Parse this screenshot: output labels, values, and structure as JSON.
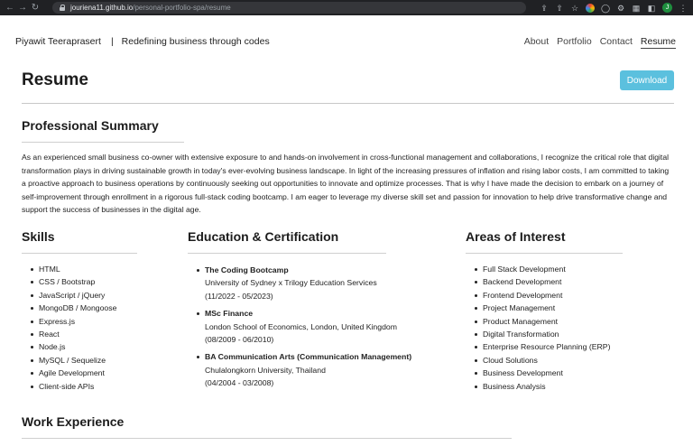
{
  "browser": {
    "url_host": "jouriena11.github.io",
    "url_path": "/personal-portfolio-spa/resume",
    "profile_initial": "J"
  },
  "header": {
    "name": "Piyawit Teeraprasert",
    "separator": "|",
    "tagline": "Redefining business through codes",
    "nav": [
      "About",
      "Portfolio",
      "Contact",
      "Resume"
    ],
    "active_nav": "Resume"
  },
  "page": {
    "title": "Resume",
    "download_label": "Download",
    "accent_color": "#5bc0de"
  },
  "summary": {
    "heading": "Professional Summary",
    "text": "As an experienced small business co-owner with extensive exposure to and hands-on involvement in cross-functional management and collaborations, I recognize the critical role that digital transformation plays in driving sustainable growth in today's ever-evolving business landscape. In light of the increasing pressures of inflation and rising labor costs, I am committed to taking a proactive approach to business operations by continuously seeking out opportunities to innovate and optimize processes. That is why I have made the decision to embark on a journey of self-improvement through enrollment in a rigorous full-stack coding bootcamp. I am eager to leverage my diverse skill set and passion for innovation to help drive transformative change and support the success of businesses in the digital age."
  },
  "skills": {
    "heading": "Skills",
    "items": [
      "HTML",
      "CSS / Bootstrap",
      "JavaScript / jQuery",
      "MongoDB / Mongoose",
      "Express.js",
      "React",
      "Node.js",
      "MySQL / Sequelize",
      "Agile Development",
      "Client-side APIs"
    ]
  },
  "education": {
    "heading": "Education & Certification",
    "items": [
      {
        "degree": "The Coding Bootcamp",
        "institution": "University of Sydney x Trilogy Education Services",
        "dates": "(11/2022 - 05/2023)"
      },
      {
        "degree": "MSc Finance",
        "institution": "London School of Economics, London, United Kingdom",
        "dates": "(08/2009 - 06/2010)"
      },
      {
        "degree": "BA Communication Arts (Communication Management)",
        "institution": "Chulalongkorn University, Thailand",
        "dates": "(04/2004 - 03/2008)"
      }
    ]
  },
  "interests": {
    "heading": "Areas of Interest",
    "items": [
      "Full Stack Development",
      "Backend Development",
      "Frontend Development",
      "Project Management",
      "Product Management",
      "Digital Transformation",
      "Enterprise Resource Planning (ERP)",
      "Cloud Solutions",
      "Business Development",
      "Business Analysis"
    ]
  },
  "work": {
    "heading": "Work Experience"
  }
}
